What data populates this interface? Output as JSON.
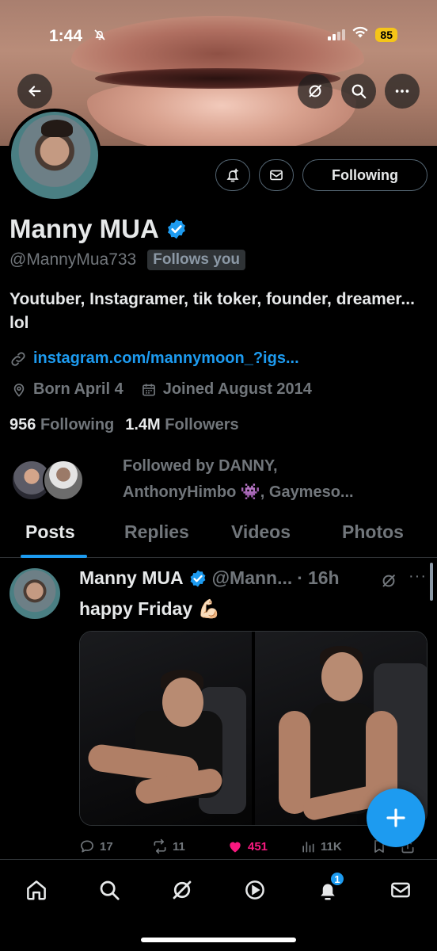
{
  "status_bar": {
    "time": "1:44",
    "battery": "85"
  },
  "profile": {
    "name": "Manny MUA",
    "handle": "@MannyMua733",
    "follows_you": "Follows you",
    "bio": "Youtuber, Instagramer, tik toker, founder, dreamer... lol",
    "link": "instagram.com/mannymoon_?igs...",
    "born": "Born April 4",
    "joined": "Joined August 2014",
    "following_count": "956",
    "following_label": "Following",
    "followers_count": "1.4M",
    "followers_label": "Followers",
    "follow_button": "Following",
    "followed_by_line1": "Followed by DANNY,",
    "followed_by_line2": "AnthonyHimbo 👾, Gaymeso..."
  },
  "tabs": [
    {
      "label": "Posts",
      "active": true
    },
    {
      "label": "Replies",
      "active": false
    },
    {
      "label": "Videos",
      "active": false
    },
    {
      "label": "Photos",
      "active": false
    }
  ],
  "post": {
    "author": "Manny MUA",
    "handle": "@Mann...",
    "separator": "·",
    "time": "16h",
    "more": "···",
    "text": "happy Friday 💪🏻",
    "replies": "17",
    "reposts": "11",
    "likes": "451",
    "views": "11K"
  },
  "bottom_nav": {
    "notification_count": "1"
  },
  "icons": {
    "back": "back-arrow-icon",
    "grok": "grok-icon",
    "search": "search-icon",
    "more": "more-icon",
    "notify": "bell-plus-icon",
    "message": "envelope-icon",
    "verified": "verified-badge-icon",
    "link": "link-icon",
    "location": "location-pin-icon",
    "calendar": "calendar-icon",
    "compose": "plus-icon"
  },
  "colors": {
    "accent": "#1d9bf0",
    "like": "#f91880",
    "muted": "#71767b",
    "text": "#e7e9ea",
    "background": "#000000"
  }
}
